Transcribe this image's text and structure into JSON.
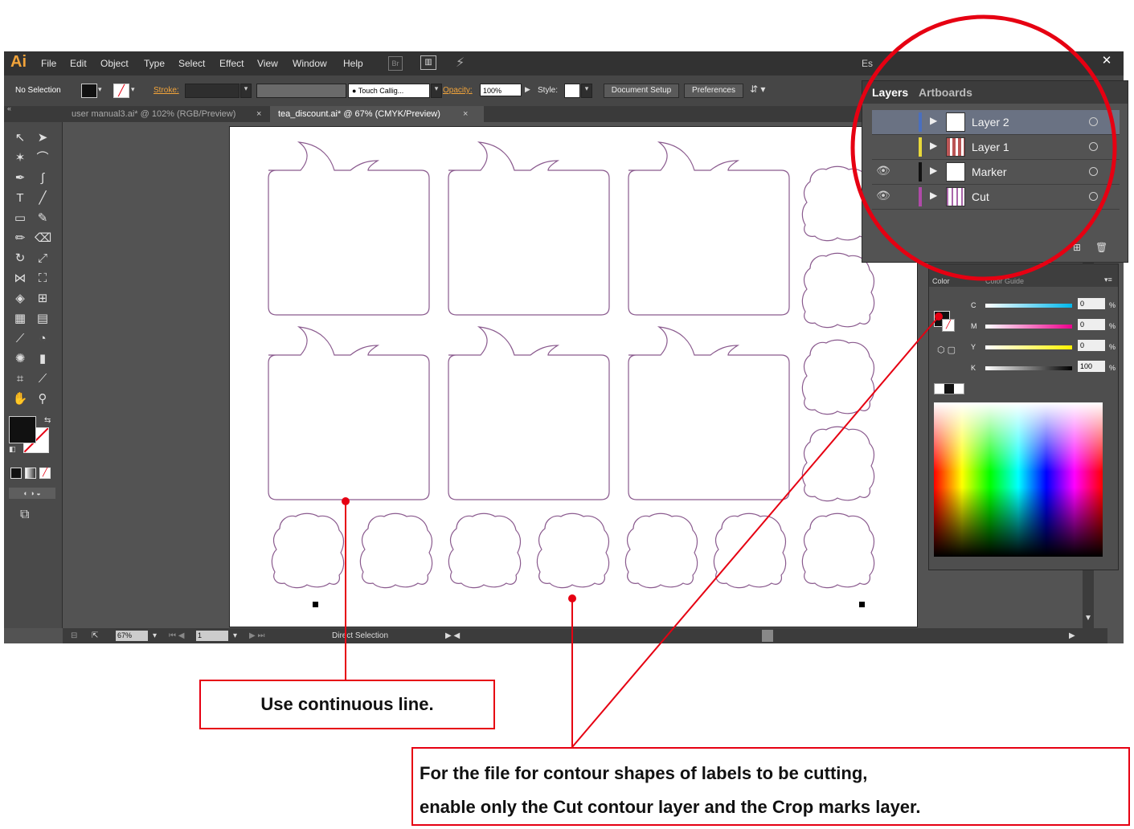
{
  "app": {
    "logo": "Ai",
    "menu": [
      "File",
      "Edit",
      "Object",
      "Type",
      "Select",
      "Effect",
      "View",
      "Window",
      "Help"
    ],
    "bridge_label": "Br",
    "workspace_label": "Es"
  },
  "control_bar": {
    "selection": "No Selection",
    "stroke_label": "Stroke:",
    "brush": "Touch Callig...",
    "opacity_label": "Opacity:",
    "opacity_value": "100%",
    "style_label": "Style:",
    "doc_setup": "Document Setup",
    "preferences": "Preferences"
  },
  "tabs": [
    {
      "label": "user manual3.ai* @ 102% (RGB/Preview)",
      "active": false
    },
    {
      "label": "tea_discount.ai* @ 67% (CMYK/Preview)",
      "active": true
    }
  ],
  "status_bar": {
    "zoom": "67%",
    "page": "1",
    "tool": "Direct Selection"
  },
  "layers_panel": {
    "tabs": [
      "Layers",
      "Artboards"
    ],
    "layers": [
      {
        "name": "Layer 2",
        "color": "#4a6fbf",
        "visible": false,
        "selected": true
      },
      {
        "name": "Layer 1",
        "color": "#e8d83a",
        "visible": false,
        "selected": false
      },
      {
        "name": "Marker",
        "color": "#111111",
        "visible": true,
        "selected": false
      },
      {
        "name": "Cut",
        "color": "#b04aa8",
        "visible": true,
        "selected": false
      }
    ]
  },
  "color_panel": {
    "title": "Color",
    "subtitle": "Color Guide",
    "channels": [
      {
        "name": "C",
        "value": "0"
      },
      {
        "name": "M",
        "value": "0"
      },
      {
        "name": "Y",
        "value": "0"
      },
      {
        "name": "K",
        "value": "100"
      }
    ],
    "pct": "%"
  },
  "annotations": {
    "callout_1": "Use continuous line.",
    "callout_2_line1": "For the file for contour shapes of labels to be cutting,",
    "callout_2_line2": "enable only the Cut contour layer and the Crop marks layer.",
    "accent": "#e60012"
  }
}
